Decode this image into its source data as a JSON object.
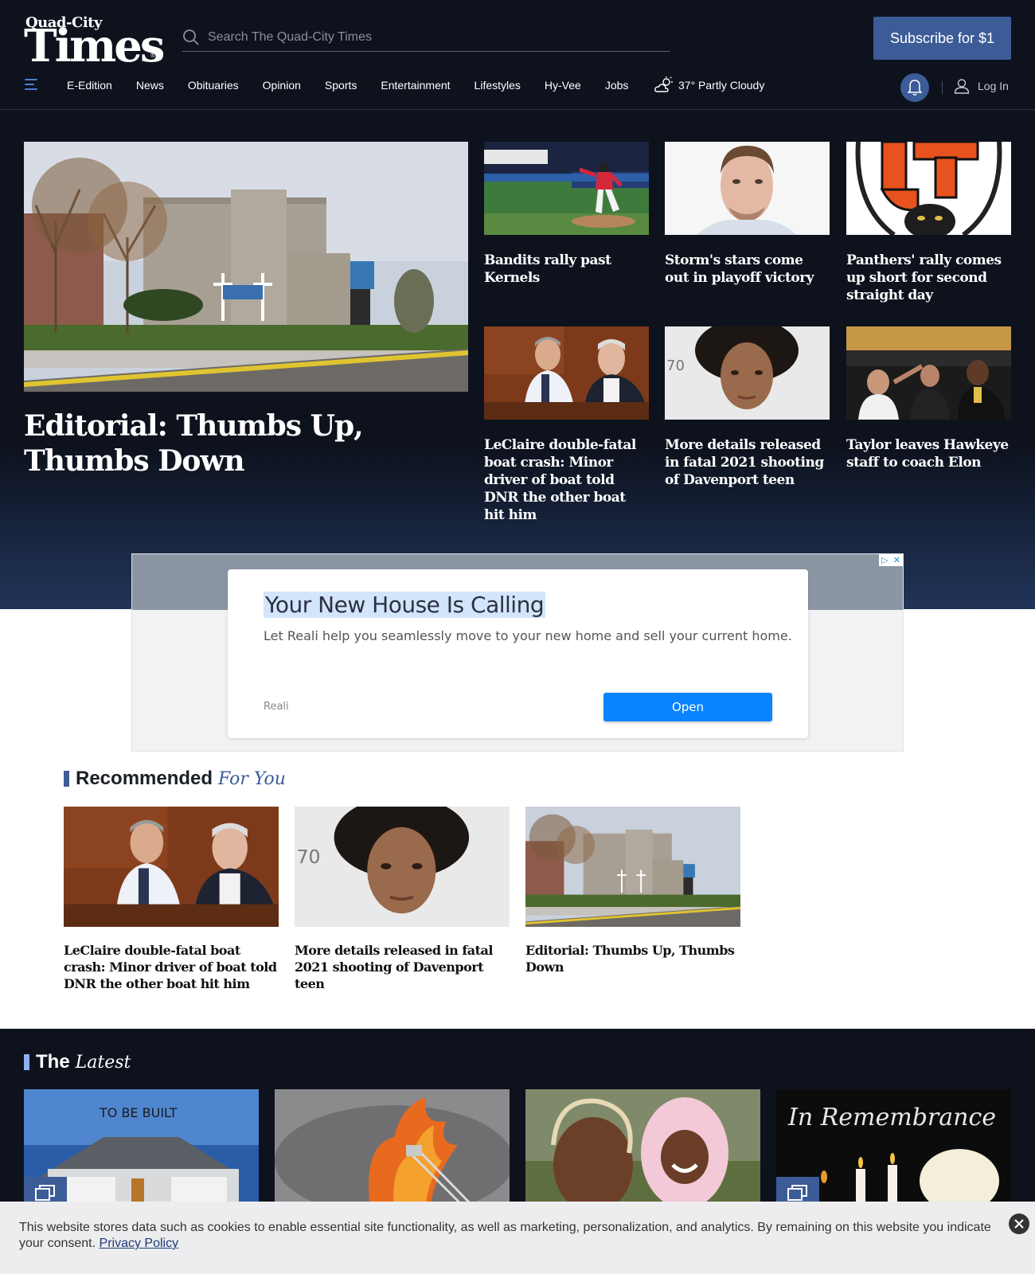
{
  "masthead": {
    "logo_top": "Quad-City",
    "logo_main": "Times",
    "search_placeholder": "Search The Quad-City Times",
    "subscribe_label": "Subscribe for $1"
  },
  "nav": {
    "items": [
      "E-Edition",
      "News",
      "Obituaries",
      "Opinion",
      "Sports",
      "Entertainment",
      "Lifestyles",
      "Hy-Vee",
      "Jobs"
    ],
    "weather": "37° Partly Cloudy",
    "login_label": "Log In"
  },
  "hero": {
    "main_headline": "Editorial: Thumbs Up, Thumbs Down",
    "tiles": [
      {
        "headline": "Bandits rally past Kernels"
      },
      {
        "headline": "Storm's stars come out in playoff victory"
      },
      {
        "headline": "Panthers' rally comes up short for second straight day"
      },
      {
        "headline": "LeClaire double-fatal boat crash: Minor driver of boat told DNR the other boat hit him"
      },
      {
        "headline": "More details released in fatal 2021 shooting of Davenport teen"
      },
      {
        "headline": "Taylor leaves Hawkeye staff to coach Elon"
      }
    ]
  },
  "ad": {
    "headline": "Your New House Is Calling",
    "description": "Let Reali help you seamlessly move to your new home and sell your current home.",
    "advertiser": "Reali",
    "cta": "Open"
  },
  "recommended": {
    "title_a": "Recommended",
    "title_b": "For You",
    "items": [
      {
        "headline": "LeClaire double-fatal boat crash: Minor driver of boat told DNR the other boat hit him"
      },
      {
        "headline": "More details released in fatal 2021 shooting of Davenport teen"
      },
      {
        "headline": "Editorial: Thumbs Up, Thumbs Down"
      }
    ]
  },
  "latest": {
    "title_a": "The",
    "title_b": "Latest",
    "img1_text": "TO BE BUILT",
    "img4_text": "In Remembrance"
  },
  "cookie": {
    "text": "This website stores data such as cookies to enable essential site functionality, as well as marketing, personalization, and analytics. By remaining on this website you indicate your consent.",
    "link": "Privacy Policy"
  },
  "colors": {
    "brand_blue": "#3c5c97",
    "dark_bg": "#0d121d",
    "ad_button": "#0a83ff"
  }
}
